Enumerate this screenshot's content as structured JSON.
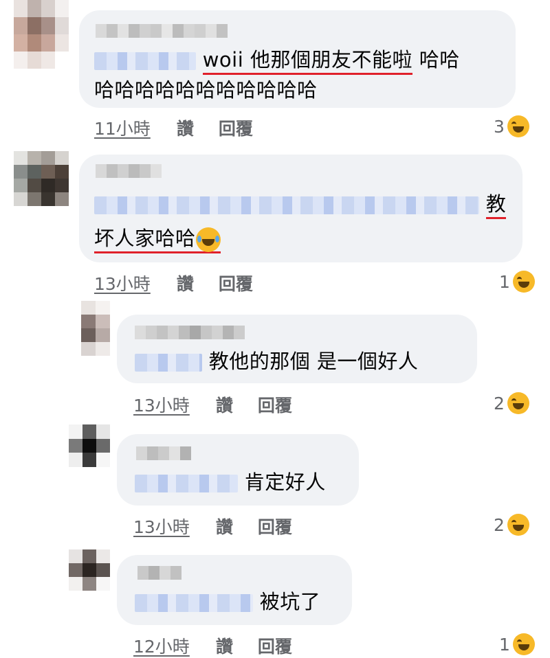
{
  "comments": [
    {
      "id": "c1",
      "text_head": "woii 他那個朋友不能啦",
      "text_tail": " 哈哈",
      "text_line2": "哈哈哈哈哈哈哈哈哈哈哈",
      "time": "11小時",
      "like": "讚",
      "reply": "回覆",
      "reaction_count": "3",
      "reaction_icon": "laughing-emoji-icon"
    },
    {
      "id": "c2",
      "text_line1_tail": "教",
      "text_line2": "坏人家哈哈",
      "time": "13小時",
      "like": "讚",
      "reply": "回覆",
      "reaction_count": "1",
      "reaction_icon": "laughing-emoji-icon"
    },
    {
      "id": "r1",
      "text": "教他的那個 是一個好人",
      "time": "13小時",
      "like": "讚",
      "reply": "回覆",
      "reaction_count": "2",
      "reaction_icon": "laughing-emoji-icon"
    },
    {
      "id": "r2",
      "text": "肯定好人",
      "time": "13小時",
      "like": "讚",
      "reply": "回覆",
      "reaction_count": "2",
      "reaction_icon": "laughing-emoji-icon"
    },
    {
      "id": "r3",
      "text": "被坑了",
      "time": "12小時",
      "like": "讚",
      "reply": "回覆",
      "reaction_count": "1",
      "reaction_icon": "laughing-emoji-icon"
    }
  ],
  "colors": {
    "bubble": "#f0f2f5",
    "meta_text": "#65676b",
    "underline_annotation": "#e0202a",
    "reaction": "#f7b928"
  }
}
